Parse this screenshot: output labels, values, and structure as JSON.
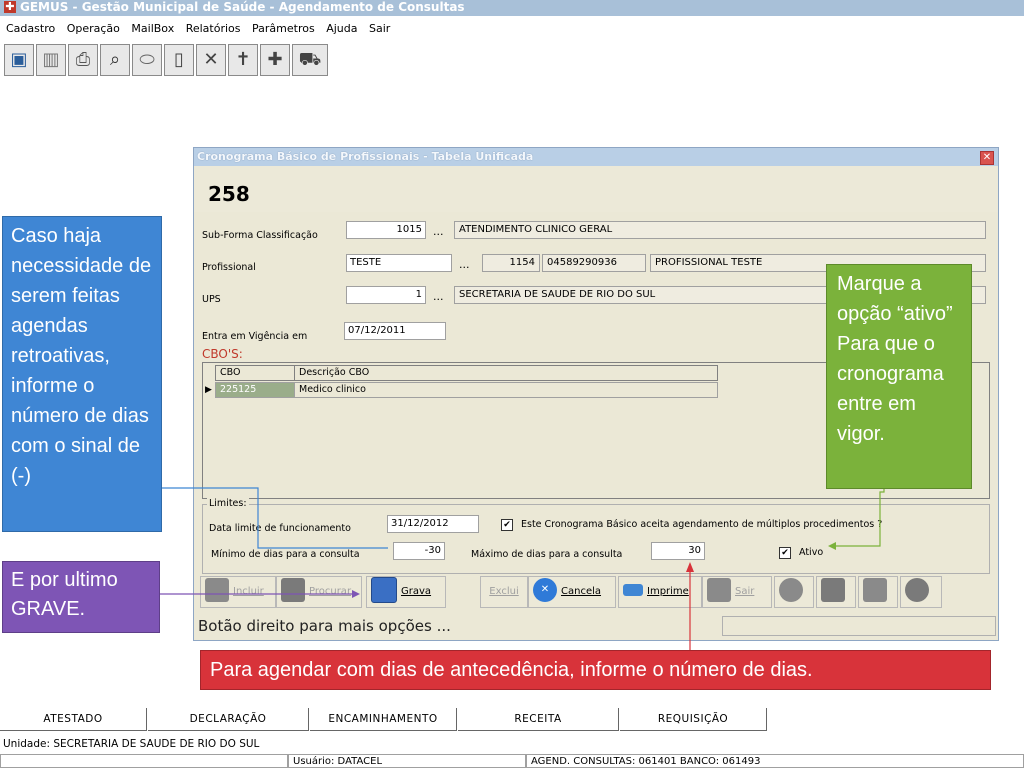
{
  "app": {
    "title": "GEMUS - Gestão Municipal de Saúde - Agendamento de Consultas",
    "menu": [
      "Cadastro",
      "Operação",
      "MailBox",
      "Relatórios",
      "Parâmetros",
      "Ajuda",
      "Sair"
    ]
  },
  "toolbar": {
    "icons": [
      "monitor-icon",
      "building-icon",
      "printer-icon",
      "search-icon",
      "pill-icon",
      "clipboard-icon",
      "tools-icon",
      "cross-icon",
      "medkit-icon",
      "ambulance-icon"
    ]
  },
  "dialog": {
    "title": "Cronograma Básico de Profissionais - Tabela Unificada",
    "number": "258",
    "fields": {
      "sub_forma_label": "Sub-Forma Classificação",
      "sub_forma_code": "1015",
      "sub_forma_desc": "ATENDIMENTO CLINICO GERAL",
      "profissional_label": "Profissional",
      "profissional_name": "TESTE",
      "profissional_code": "1154",
      "profissional_doc": "04589290936",
      "profissional_desc": "PROFISSIONAL TESTE",
      "ups_label": "UPS",
      "ups_code": "1",
      "ups_desc": "SECRETARIA DE SAUDE DE RIO DO SUL",
      "vigencia_label": "Entra em Vigência em",
      "vigencia_value": "07/12/2011",
      "ellipsis": "..."
    },
    "cbos": {
      "label": "CBO'S:",
      "columns": [
        "CBO",
        "Descrição CBO"
      ],
      "rows": [
        {
          "cbo": "225125",
          "descricao": "Medico clinico"
        }
      ]
    },
    "limits": {
      "legend": "Limites:",
      "data_limite_label": "Data limite de funcionamento",
      "data_limite_value": "31/12/2012",
      "multi_label": "Este Cronograma Básico aceita agendamento de múltiplos procedimentos ?",
      "multi_checked": true,
      "min_label": "Mínimo de dias para  a consulta",
      "min_value": "-30",
      "max_label": "Máximo de dias para a consulta",
      "max_value": "30",
      "ativo_label": "Ativo",
      "ativo_checked": true
    },
    "buttons": {
      "incluir": "Incluir",
      "procurar": "Procurar",
      "grava": "Grava",
      "exclui": "Exclui",
      "cancela": "Cancela",
      "imprime": "Imprime",
      "sair": "Sair"
    },
    "status_hint": "Botão direito para mais opções ..."
  },
  "callouts": {
    "blue": "Caso haja necessidade de serem feitas agendas retroativas, informe o número de dias com o sinal de (-)",
    "purple": "E por ultimo GRAVE.",
    "green": "Marque a opção “ativo” Para que o cronograma entre em vigor.",
    "red": "Para agendar com dias de antecedência, informe o número de dias."
  },
  "bottom": {
    "tabs": [
      "ATESTADO",
      "DECLARAÇÃO",
      "ENCAMINHAMENTO",
      "RECEITA",
      "REQUISIÇÃO"
    ],
    "unit": "Unidade: SECRETARIA DE SAUDE DE RIO DO SUL",
    "user": "Usuário: DATACEL",
    "agend": "AGEND. CONSULTAS: 061401 BANCO: 061493"
  },
  "colors": {
    "callout_blue": "#3f86d4",
    "callout_purple": "#7e55b5",
    "callout_green": "#7bb23b",
    "callout_red": "#d8333a"
  }
}
